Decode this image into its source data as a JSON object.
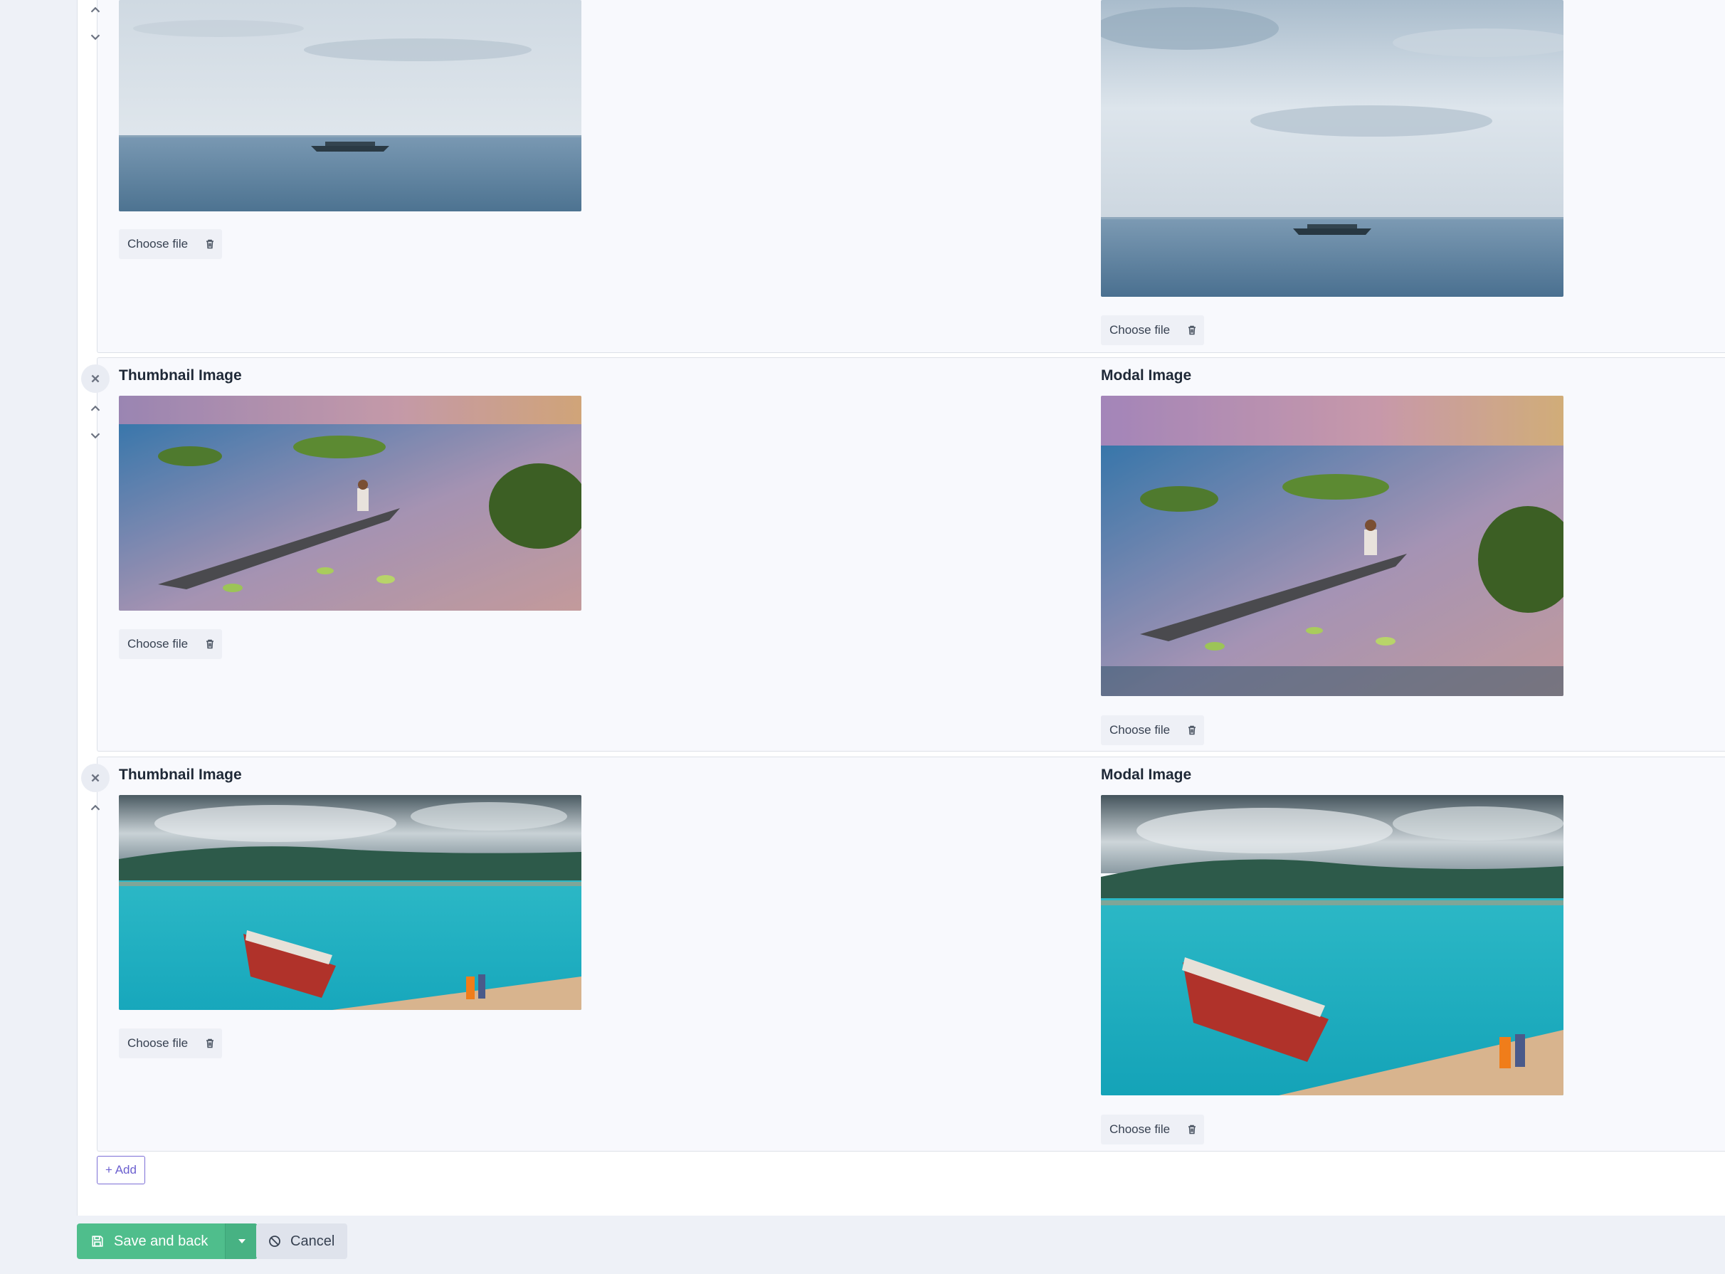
{
  "rows": [
    {
      "thumbnail_label": "",
      "modal_label": "",
      "thumbnail_file": {
        "choose_label": "Choose file"
      },
      "modal_file": {
        "choose_label": "Choose file"
      }
    },
    {
      "thumbnail_label": "Thumbnail Image",
      "modal_label": "Modal Image",
      "thumbnail_file": {
        "choose_label": "Choose file"
      },
      "modal_file": {
        "choose_label": "Choose file"
      }
    },
    {
      "thumbnail_label": "Thumbnail Image",
      "modal_label": "Modal Image",
      "thumbnail_file": {
        "choose_label": "Choose file"
      },
      "modal_file": {
        "choose_label": "Choose file"
      }
    }
  ],
  "add_button": {
    "label": "+ Add"
  },
  "footer": {
    "save_label": "Save and back",
    "cancel_label": "Cancel"
  },
  "icons": {
    "remove": "close-icon",
    "move_up": "chevron-up-icon",
    "move_down": "chevron-down-icon",
    "delete_file": "trash-icon",
    "save": "floppy-disk-icon",
    "dropdown": "caret-down-icon",
    "cancel": "ban-icon"
  },
  "colors": {
    "save_button": "#4fbe8c",
    "add_button_border": "#7c6fd6",
    "cancel_button": "#dfe3ec"
  }
}
